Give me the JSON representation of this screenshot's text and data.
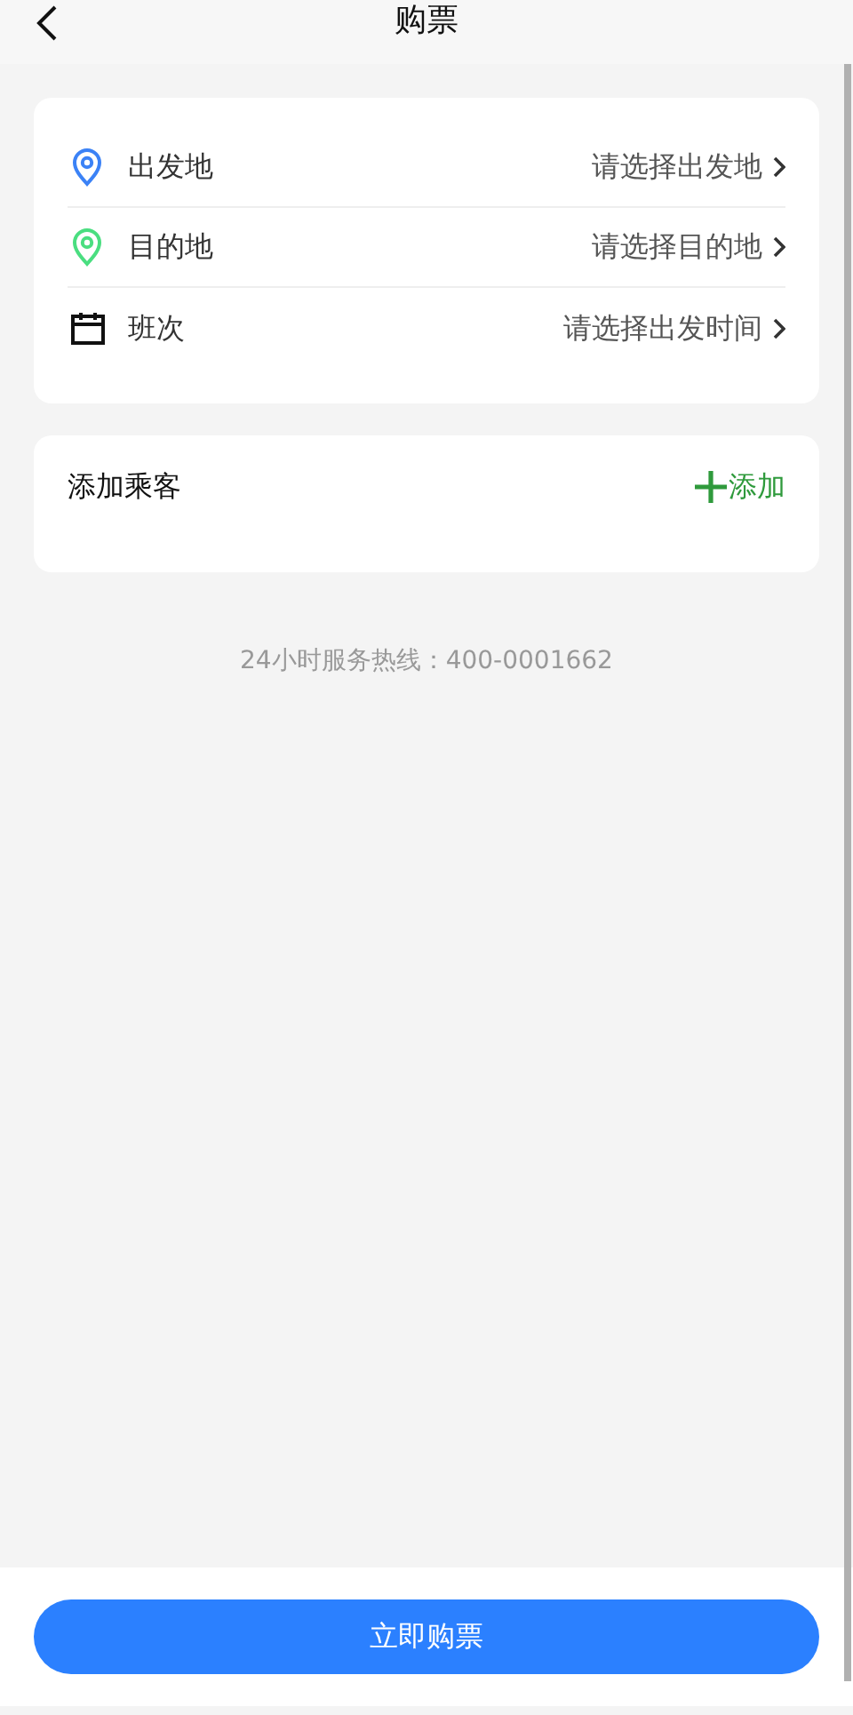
{
  "header": {
    "title": "购票"
  },
  "route_rows": [
    {
      "kind": "pin",
      "color": "#3b82f6",
      "label": "出发地",
      "value": "请选择出发地"
    },
    {
      "kind": "pin",
      "color": "#4ade80",
      "label": "目的地",
      "value": "请选择目的地"
    },
    {
      "kind": "calendar",
      "label": "班次",
      "value": "请选择出发时间"
    }
  ],
  "passengers": {
    "title": "添加乘客",
    "add_button": "添加"
  },
  "hotline": "24小时服务热线：400-0001662",
  "submit_button": "立即购票"
}
